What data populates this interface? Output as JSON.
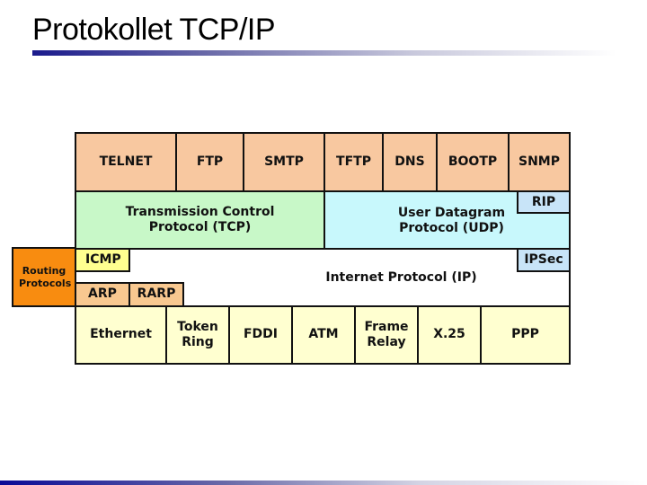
{
  "slide": {
    "title": "Protokollet TCP/IP"
  },
  "diagram": {
    "application_layer": [
      "TELNET",
      "FTP",
      "SMTP",
      "TFTP",
      "DNS",
      "BOOTP",
      "SNMP"
    ],
    "transport_layer": {
      "tcp": "Transmission Control Protocol (TCP)",
      "udp": "User Datagram Protocol (UDP)",
      "rip": "RIP"
    },
    "internet_layer": {
      "ip": "Internet Protocol (IP)",
      "icmp": "ICMP",
      "ipsec": "IPSec",
      "arp": "ARP",
      "rarp": "RARP",
      "routing": "Routing Protocols"
    },
    "link_layer": [
      "Ethernet",
      "Token Ring",
      "FDDI",
      "ATM",
      "Frame Relay",
      "X.25",
      "PPP"
    ]
  },
  "colors": {
    "application": "#f8c8a0",
    "tcp": "#c8f8c8",
    "udp": "#c8f8fc",
    "rip_ipsec": "#c8e4f8",
    "icmp": "#ffff90",
    "arp": "#f8c890",
    "routing": "#f88c10",
    "link": "#ffffd0"
  }
}
